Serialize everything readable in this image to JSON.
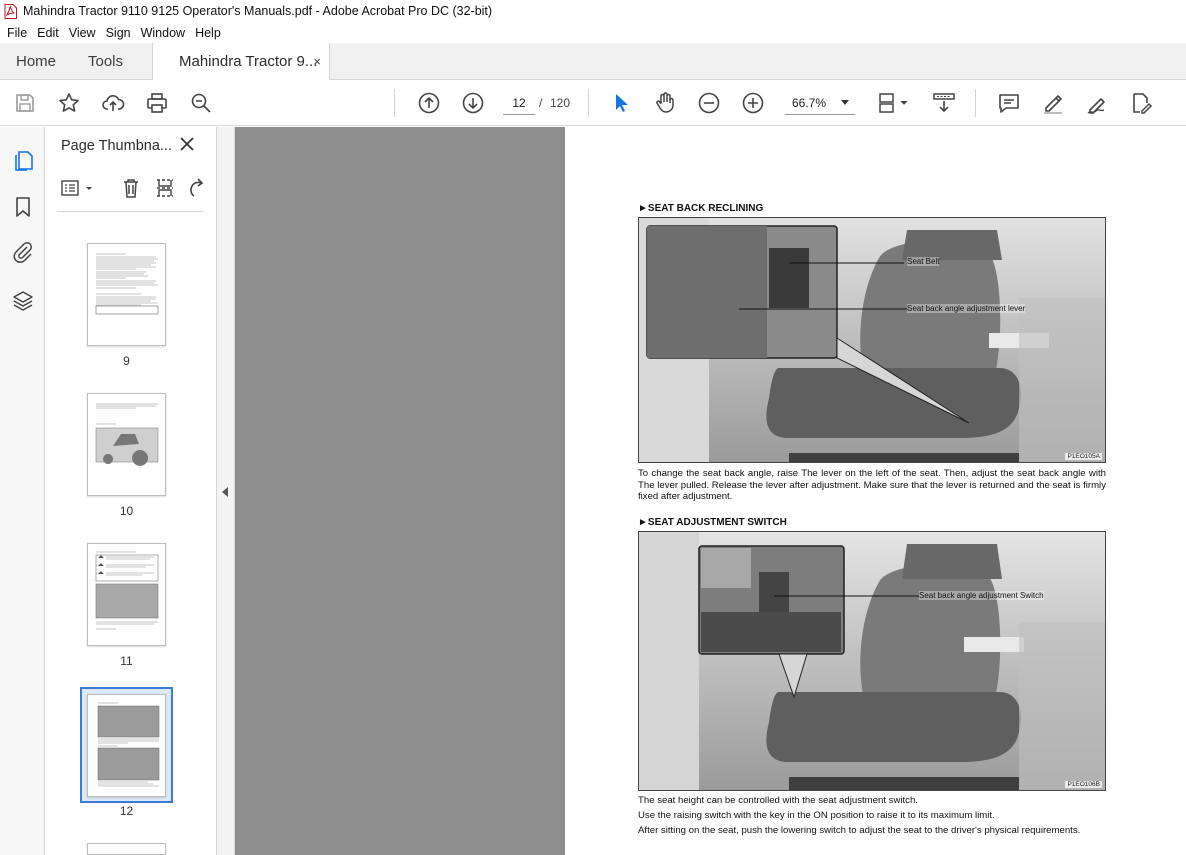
{
  "window": {
    "title": "Mahindra Tractor 9110 9125 Operator's Manuals.pdf - Adobe Acrobat Pro DC (32-bit)"
  },
  "menu": [
    "File",
    "Edit",
    "View",
    "Sign",
    "Window",
    "Help"
  ],
  "tabs": {
    "home": "Home",
    "tools": "Tools",
    "document": "Mahindra Tractor 9...",
    "close": "×"
  },
  "toolbar": {
    "current_page": "12",
    "page_separator": "/",
    "total_pages": "120",
    "zoom": "66.7%",
    "icons": [
      "save-icon",
      "star-icon",
      "upload-icon",
      "print-icon",
      "search-zoom-icon",
      "prev-page-icon",
      "next-page-icon",
      "select-cursor-icon",
      "hand-icon",
      "zoom-out-icon",
      "zoom-in-icon",
      "page-fit-icon",
      "scroll-mode-icon",
      "comment-icon",
      "highlight-pen-icon",
      "sign-icon",
      "edit-pdf-icon"
    ]
  },
  "thumbnail_panel": {
    "title": "Page Thumbna...",
    "pages": [
      {
        "label": "9"
      },
      {
        "label": "10"
      },
      {
        "label": "11"
      },
      {
        "label": "12"
      }
    ],
    "selected_page": "12"
  },
  "document": {
    "section1": {
      "heading": "►SEAT BACK RECLINING",
      "callout_belt": "Seat Belt",
      "callout_lever": "Seat back angle adjustment lever",
      "photo_code": "P1EO105A",
      "text": "To change the seat back angle, raise The lever on the left of the seat. Then, adjust the seat back angle with The lever pulled. Release the lever after adjustment. Make sure that the lever is returned and the seat is firmly fixed after adjustment."
    },
    "section2": {
      "heading": "►SEAT ADJUSTMENT SWITCH",
      "callout_switch": "Seat back angle adjustment Switch",
      "photo_code": "P1EO106B",
      "text1": "The seat height can be controlled with the seat adjustment switch.",
      "text2": "Use the raising switch with the key in the ON position to raise it to its maximum limit.",
      "text3": "After sitting on the seat, push the lowering switch to adjust the seat to the driver's physical requirements."
    }
  }
}
